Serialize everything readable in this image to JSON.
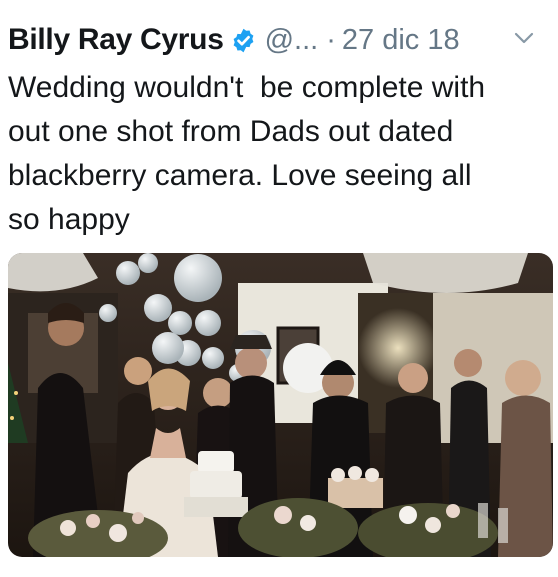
{
  "tweet": {
    "author_name": "Billy Ray Cyrus",
    "verified_icon": "verified-badge-icon",
    "handle": "@...",
    "separator": "·",
    "date": "27 dic 18",
    "menu_icon": "chevron-down-icon",
    "text": "Wedding wouldn't  be complete with\nout one shot from Dads out dated\nblackberry camera. Love seeing all\nso happy",
    "colors": {
      "name": "#14171a",
      "secondary": "#657786",
      "verified": "#1da1f2"
    }
  }
}
